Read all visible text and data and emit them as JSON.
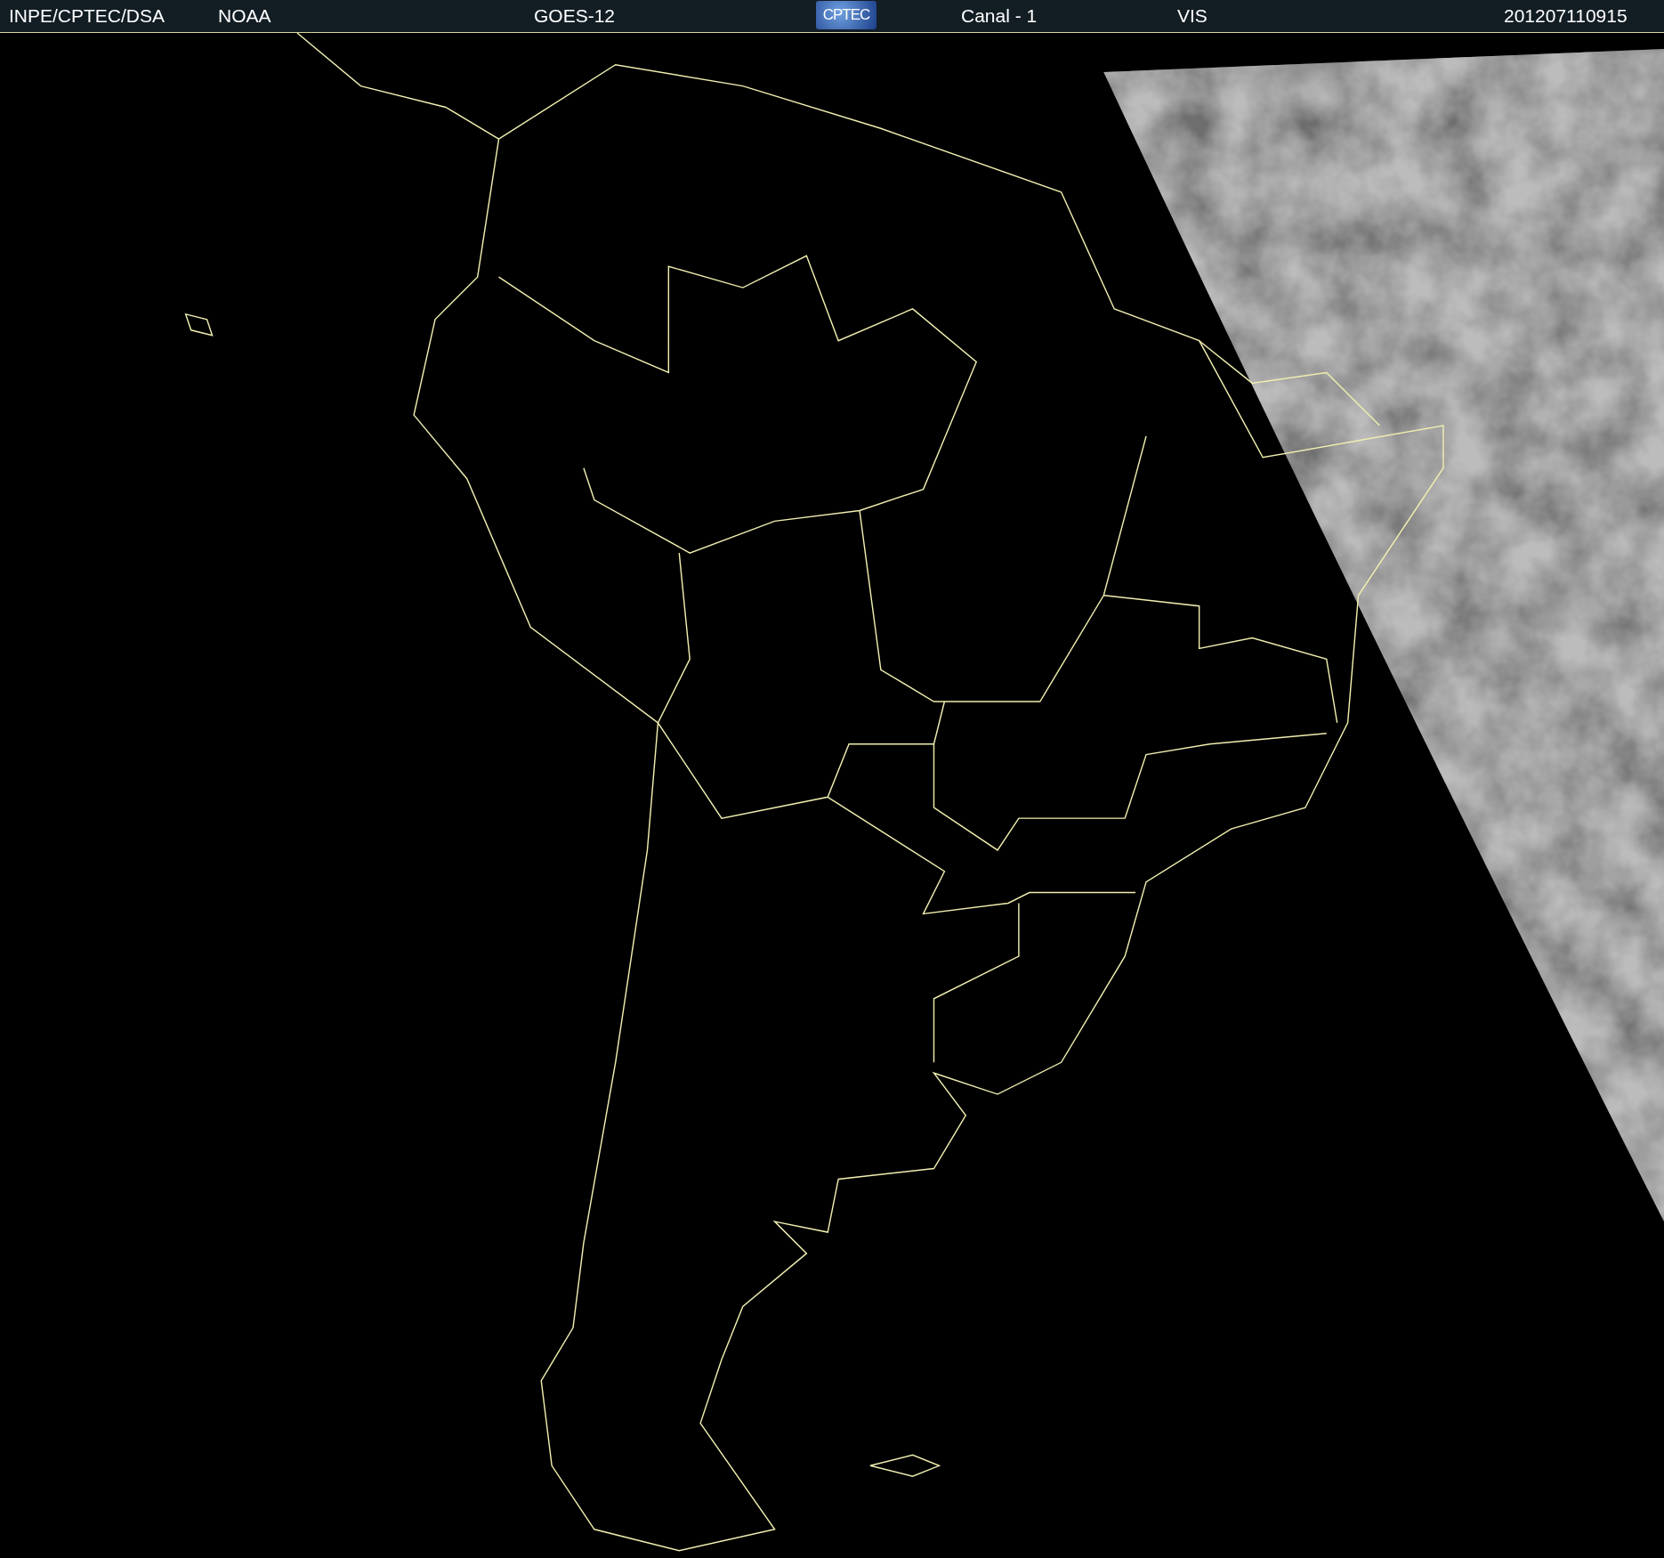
{
  "header": {
    "items": [
      {
        "kind": "text",
        "text": "INPE/CPTEC/DSA"
      },
      {
        "kind": "text",
        "text": "NOAA"
      },
      {
        "kind": "text",
        "text": "GOES-12"
      },
      {
        "kind": "logo",
        "text": "CPTEC"
      },
      {
        "kind": "text",
        "text": "Canal - 1"
      },
      {
        "kind": "text",
        "text": "VIS"
      },
      {
        "kind": "text",
        "text": "201207110915"
      }
    ]
  }
}
